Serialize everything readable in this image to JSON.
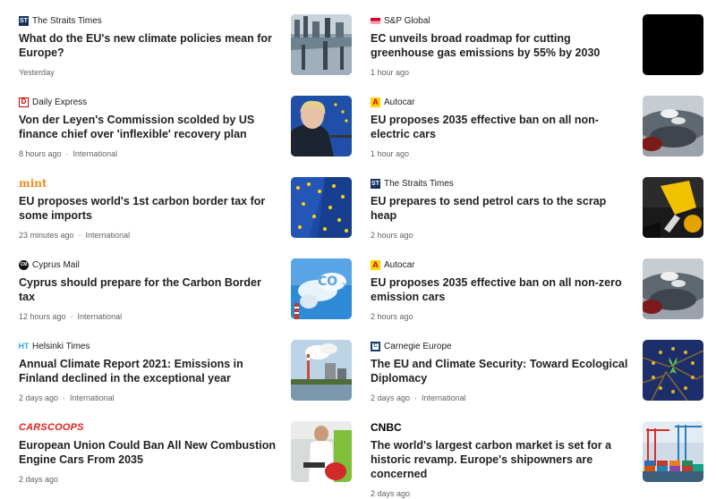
{
  "columns": [
    [
      {
        "source": "The Straits Times",
        "logo": "ST",
        "logo_style": "st",
        "headline": "What do the EU's new climate policies mean for Europe?",
        "time": "Yesterday",
        "category": "",
        "thumb": "city-reflection"
      },
      {
        "source": "Daily Express",
        "logo": "D",
        "logo_style": "express",
        "headline": "Von der Leyen's Commission scolded by US finance chief over 'inflexible' recovery plan",
        "time": "8 hours ago",
        "category": "International",
        "thumb": "portrait-eu"
      },
      {
        "source": "",
        "logo": "mint",
        "logo_style": "mint",
        "headline": "EU proposes world's 1st carbon border tax for some imports",
        "time": "23 minutes ago",
        "category": "International",
        "thumb": "eu-flags"
      },
      {
        "source": "Cyprus Mail",
        "logo": "CM",
        "logo_style": "cyprus",
        "headline": "Cyprus should prepare for the Carbon Border tax",
        "time": "12 hours ago",
        "category": "International",
        "thumb": "co2-sky"
      },
      {
        "source": "Helsinki Times",
        "logo": "HT",
        "logo_style": "ht",
        "headline": "Annual Climate Report 2021: Emissions in Finland declined in the exceptional year",
        "time": "2 days ago",
        "category": "International",
        "thumb": "power-plant"
      },
      {
        "source": "",
        "logo": "CARSCOOPS",
        "logo_style": "carscoops",
        "headline": "European Union Could Ban All New Combustion Engine Cars From 2035",
        "time": "2 days ago",
        "category": "",
        "thumb": "fuel-man"
      }
    ],
    [
      {
        "source": "S&P Global",
        "logo": "",
        "logo_style": "sp",
        "headline": "EC unveils broad roadmap for cutting greenhouse gas emissions by 55% by 2030",
        "time": "1 hour ago",
        "category": "",
        "thumb": "black"
      },
      {
        "source": "Autocar",
        "logo": "A",
        "logo_style": "autocar",
        "headline": "EU proposes 2035 effective ban on all non-electric cars",
        "time": "1 hour ago",
        "category": "",
        "thumb": "exhaust"
      },
      {
        "source": "The Straits Times",
        "logo": "ST",
        "logo_style": "st",
        "headline": "EU prepares to send petrol cars to the scrap heap",
        "time": "2 hours ago",
        "category": "",
        "thumb": "nozzle"
      },
      {
        "source": "Autocar",
        "logo": "A",
        "logo_style": "autocar",
        "headline": "EU proposes 2035 effective ban on all non-zero emission cars",
        "time": "2 hours ago",
        "category": "",
        "thumb": "exhaust"
      },
      {
        "source": "Carnegie Europe",
        "logo": "C",
        "logo_style": "carnegie",
        "headline": "The EU and Climate Security: Toward Ecological Diplomacy",
        "time": "2 days ago",
        "category": "International",
        "thumb": "eu-cracked"
      },
      {
        "source": "",
        "logo": "CNBC",
        "logo_style": "cnbc",
        "headline": "The world's largest carbon market is set for a historic revamp. Europe's shipowners are concerned",
        "time": "2 days ago",
        "category": "",
        "thumb": "port-cranes"
      }
    ]
  ]
}
